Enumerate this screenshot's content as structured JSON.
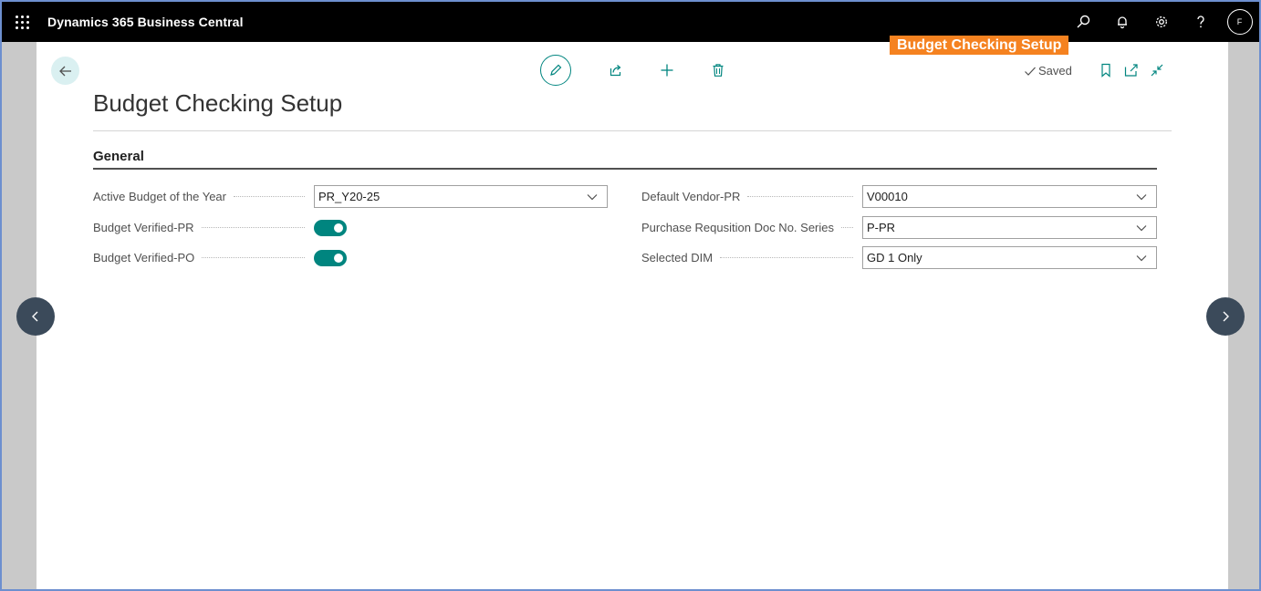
{
  "app": {
    "title": "Dynamics 365 Business Central",
    "user_initial": "F"
  },
  "callout": {
    "text": "Budget Checking Setup"
  },
  "page": {
    "title": "Budget Checking Setup",
    "status": "Saved",
    "section_title": "General"
  },
  "fields_left": [
    {
      "label": "Active Budget of the Year",
      "type": "select",
      "value": "PR_Y20-25"
    },
    {
      "label": "Budget Verified-PR",
      "type": "toggle",
      "value": "on"
    },
    {
      "label": "Budget Verified-PO",
      "type": "toggle",
      "value": "on"
    }
  ],
  "fields_right": [
    {
      "label": "Default Vendor-PR",
      "type": "select",
      "value": "V00010"
    },
    {
      "label": "Purchase Requsition Doc No. Series",
      "type": "select",
      "value": "P-PR"
    },
    {
      "label": "Selected DIM",
      "type": "select",
      "value": "GD 1 Only"
    }
  ],
  "colors": {
    "accent": "#00857f",
    "topbar": "#000000",
    "callout": "#f58220"
  }
}
